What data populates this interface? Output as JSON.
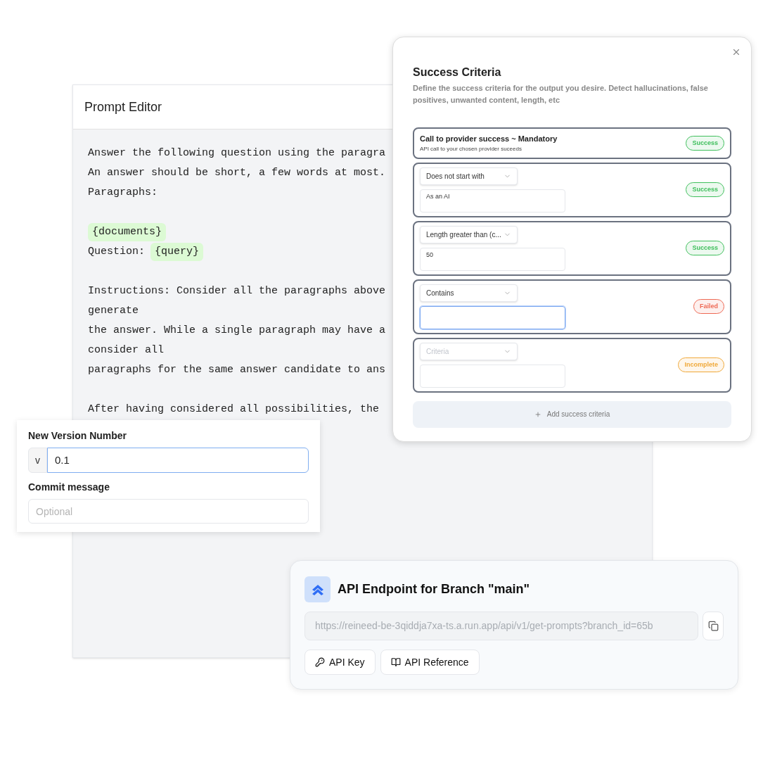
{
  "prompt_editor": {
    "title": "Prompt Editor",
    "lines": [
      {
        "kind": "text",
        "text": "Answer the following question using the paragra"
      },
      {
        "kind": "text",
        "text": "An answer should be short, a few words at most."
      },
      {
        "kind": "text",
        "text": "Paragraphs:"
      },
      {
        "kind": "blank"
      },
      {
        "kind": "vars",
        "variable": "{documents}"
      },
      {
        "kind": "vars",
        "prefix": "Question:",
        "variable": "{query}"
      },
      {
        "kind": "blank"
      },
      {
        "kind": "text",
        "text": "Instructions: Consider all the paragraphs above"
      },
      {
        "kind": "text",
        "text": "generate"
      },
      {
        "kind": "text",
        "text": "the answer. While a single paragraph may have a"
      },
      {
        "kind": "text",
        "text": "consider all"
      },
      {
        "kind": "text",
        "text": "paragraphs for the same answer candidate to ans"
      },
      {
        "kind": "blank"
      },
      {
        "kind": "text",
        "text": "After having considered all possibilities, the"
      }
    ]
  },
  "version_form": {
    "version_label": "New Version Number",
    "prefix": "v",
    "version_value": "0.1",
    "message_label": "Commit message",
    "message_placeholder": "Optional"
  },
  "success_criteria": {
    "title": "Success Criteria",
    "description": "Define the success criteria for the output you desire. Detect hallucinations, false positives, unwanted content, length, etc",
    "criteria": [
      {
        "kind": "fixed",
        "title": "Call to provider success ~ Mandatory",
        "subtitle": "API call to your chosen provider suceeds",
        "badge": "Success",
        "color": "#3fbf5c"
      },
      {
        "kind": "rule",
        "select": "Does not start with",
        "value": "As an AI",
        "focused": false,
        "badge": "Success",
        "color": "#3fbf5c"
      },
      {
        "kind": "rule",
        "select": "Length greater than (c...",
        "value": "50",
        "focused": false,
        "badge": "Success",
        "color": "#3fbf5c"
      },
      {
        "kind": "rule",
        "select": "Contains",
        "focused": true,
        "badge": "Failed",
        "color": "#ee6a55"
      },
      {
        "kind": "rule",
        "select_placeholder": "Criteria",
        "focused": false,
        "badge": "Incomplete",
        "color": "#f0a93a"
      }
    ],
    "add_button": "Add success criteria"
  },
  "api_endpoint": {
    "title": "API Endpoint for Branch \"main\"",
    "url": "https://reineed-be-3qiddja7xa-ts.a.run.app/api/v1/get-prompts?branch_id=65b",
    "buttons": [
      {
        "kind": "key",
        "label": "API Key"
      },
      {
        "kind": "book",
        "label": "API Reference"
      }
    ]
  }
}
